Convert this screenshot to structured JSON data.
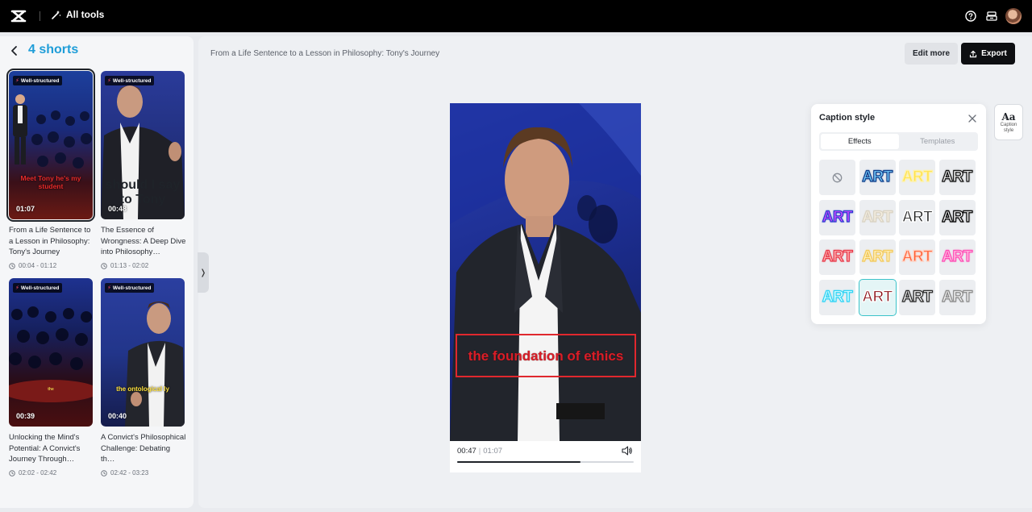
{
  "topbar": {
    "all_tools_label": "All tools"
  },
  "sidebar": {
    "title": "4 shorts",
    "cards": [
      {
        "badge": "Well-structured",
        "duration": "01:07",
        "caption": "Meet Tony he's my student",
        "title": "From a Life Sentence to a Lesson in Philosophy: Tony's Journey",
        "range": "00:04 - 01:12",
        "selected": true
      },
      {
        "badge": "Well-structured",
        "duration": "00:48",
        "caption": "should I say to Tony",
        "title": "The Essence of Wrongness: A Deep Dive into Philosophy…",
        "range": "01:13 - 02:02",
        "selected": false
      },
      {
        "badge": "Well-structured",
        "duration": "00:39",
        "caption": "the",
        "title": "Unlocking the Mind's Potential: A Convict's Journey Through…",
        "range": "02:02 - 02:42",
        "selected": false
      },
      {
        "badge": "Well-structured",
        "duration": "00:40",
        "caption": "the ontological ly",
        "title": "A Convict's Philosophical Challenge: Debating th…",
        "range": "02:42 - 03:23",
        "selected": false
      }
    ]
  },
  "header": {
    "breadcrumb": "From a Life Sentence to a Lesson in Philosophy: Tony's Journey",
    "edit_more_label": "Edit more",
    "export_label": "Export"
  },
  "player": {
    "caption_text": "the foundation of ethics",
    "current_time": "00:47",
    "total_time": "01:07",
    "progress": 0.7
  },
  "caption_style": {
    "title": "Caption style",
    "tabs": [
      "Effects",
      "Templates"
    ],
    "active_tab": "Effects",
    "tile_text": "ART",
    "side_button_label": "Caption style",
    "side_button_icon_text": "Aa",
    "styles": [
      {
        "name": "none"
      },
      {
        "name": "blue-outline",
        "fill": "#7fd3ff",
        "stroke": "#0b3c8a"
      },
      {
        "name": "yellow-glow",
        "fill": "#ffe14a",
        "stroke": "#fff2a6"
      },
      {
        "name": "white-black",
        "fill": "#ffffff",
        "stroke": "#111111"
      },
      {
        "name": "purple-gradient",
        "fill": "#d64bff",
        "stroke": "#2b3bd1"
      },
      {
        "name": "cream-soft",
        "fill": "#f5efe2",
        "stroke": "#d9d2c2"
      },
      {
        "name": "black-white",
        "fill": "#1a1a1a",
        "stroke": "#ffffff"
      },
      {
        "name": "white-heavy",
        "fill": "#ffffff",
        "stroke": "#000000"
      },
      {
        "name": "pink-red",
        "fill": "#ffb3b3",
        "stroke": "#e8394a"
      },
      {
        "name": "cream-yellow",
        "fill": "#fff3c4",
        "stroke": "#f3c95a"
      },
      {
        "name": "red-orange",
        "fill": "#ff5a2e",
        "stroke": "#ffd1c2"
      },
      {
        "name": "pink-neon",
        "fill": "#ffc1e3",
        "stroke": "#ff4db5"
      },
      {
        "name": "cyan-neon",
        "fill": "#e6ffff",
        "stroke": "#2ed3f5"
      },
      {
        "name": "dark-red",
        "fill": "#8a0b12",
        "stroke": "#ffffff",
        "selected": true
      },
      {
        "name": "white-outline",
        "fill": "#ffffff",
        "stroke": "#2a2a2a"
      },
      {
        "name": "grey-outline",
        "fill": "#f7f7f7",
        "stroke": "#8a8a8a"
      }
    ]
  },
  "colors": {
    "accent": "#1e9dd8",
    "selected_tile": "#3bc3c9",
    "caption_red": "#d91e28"
  }
}
